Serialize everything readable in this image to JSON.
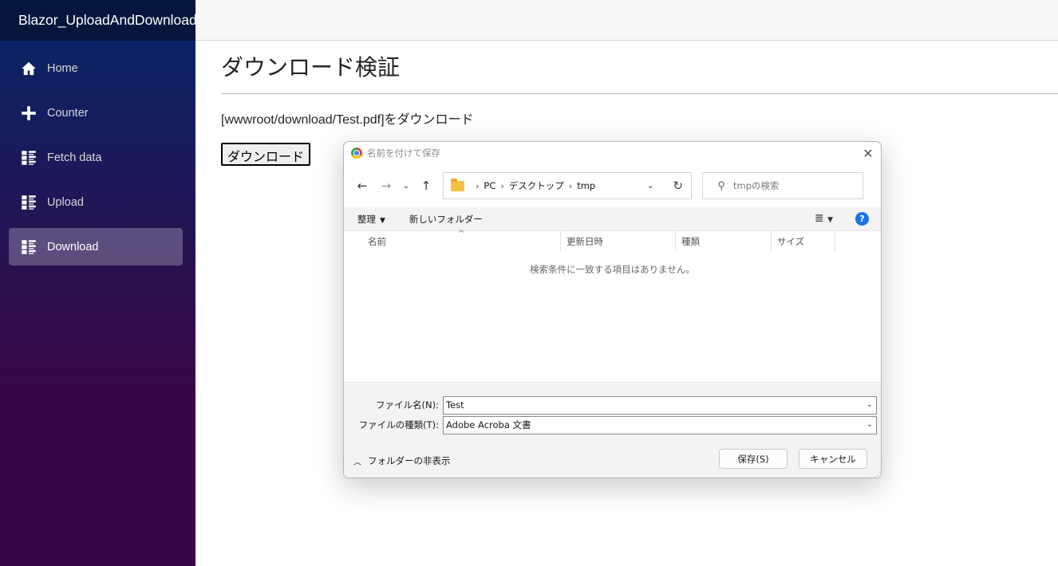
{
  "app": {
    "brand": "Blazor_UploadAndDownload"
  },
  "sidebar": {
    "items": [
      {
        "label": "Home",
        "icon": "home-icon"
      },
      {
        "label": "Counter",
        "icon": "plus-icon"
      },
      {
        "label": "Fetch data",
        "icon": "list-icon"
      },
      {
        "label": "Upload",
        "icon": "list-icon"
      },
      {
        "label": "Download",
        "icon": "list-icon",
        "active": true
      }
    ]
  },
  "main": {
    "title": "ダウンロード検証",
    "description": "[wwwroot/download/Test.pdf]をダウンロード",
    "download_button": "ダウンロード"
  },
  "dialog": {
    "title": "名前を付けて保存",
    "breadcrumb": [
      "PC",
      "デスクトップ",
      "tmp"
    ],
    "search_placeholder": "tmpの検索",
    "toolbar": {
      "organize": "整理",
      "new_folder": "新しいフォルダー"
    },
    "columns": {
      "name": "名前",
      "modified": "更新日時",
      "type": "種類",
      "size": "サイズ"
    },
    "empty_message": "検索条件に一致する項目はありません。",
    "filename_label": "ファイル名(N):",
    "filename_value": "Test",
    "filetype_label": "ファイルの種類(T):",
    "filetype_value": "Adobe Acroba 文書",
    "hide_folders": "フォルダーの非表示",
    "save_button": "保存(S)",
    "cancel_button": "キャンセル"
  },
  "colors": {
    "sidebar_top": "#052767",
    "sidebar_bottom": "#3a0647",
    "help_blue": "#1a73e8"
  }
}
